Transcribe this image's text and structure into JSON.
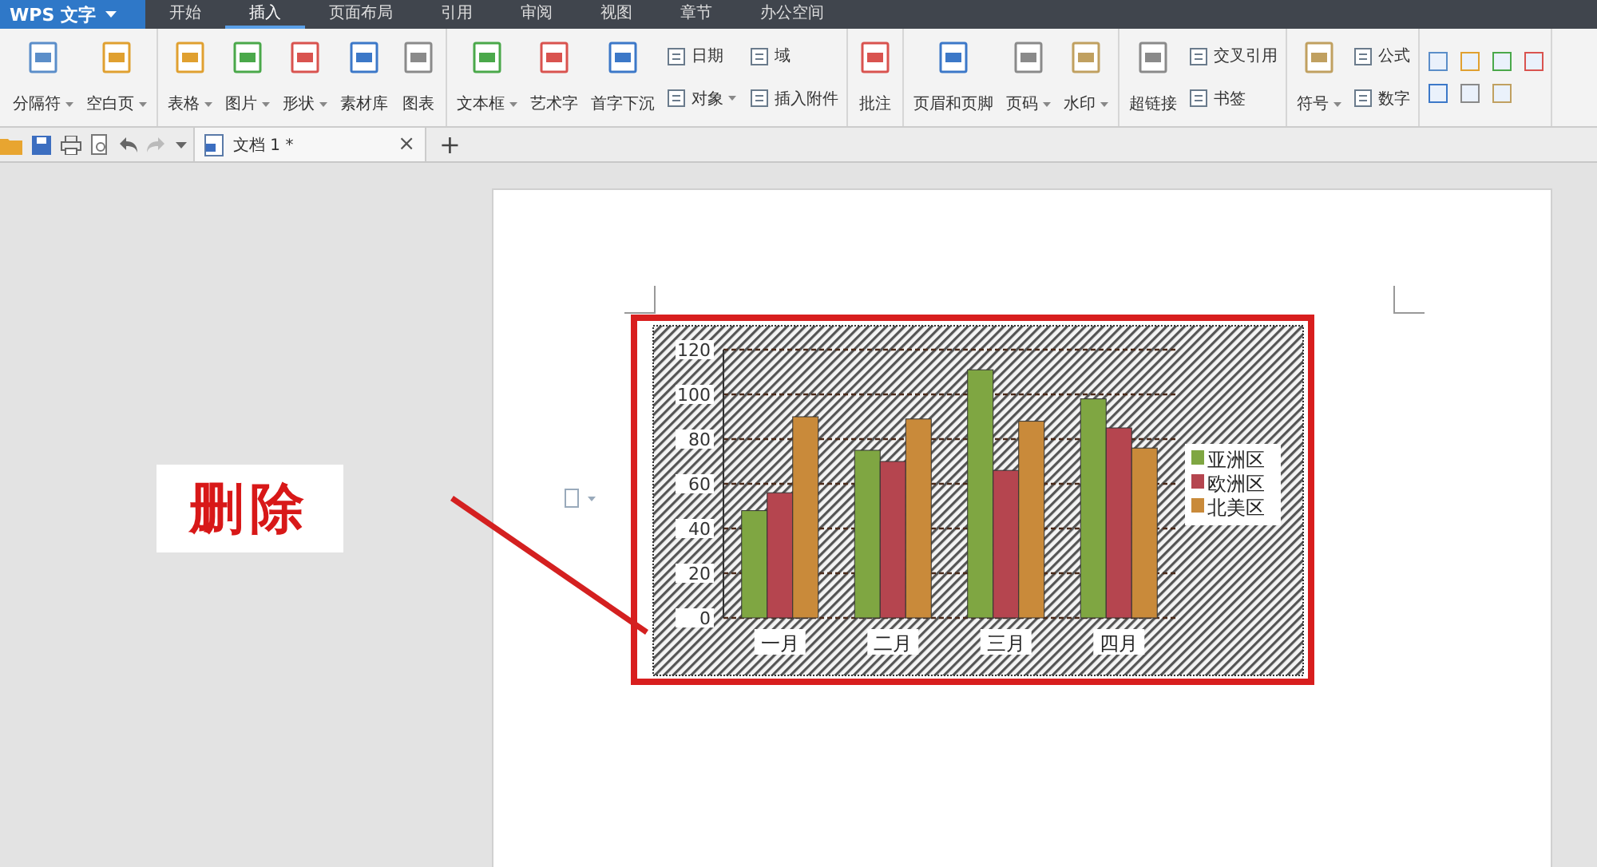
{
  "app_menu": {
    "label": "WPS 文字",
    "dropdown": true
  },
  "menu_tabs": [
    {
      "label": "开始",
      "selected": false
    },
    {
      "label": "插入",
      "selected": true
    },
    {
      "label": "页面布局",
      "selected": false
    },
    {
      "label": "引用",
      "selected": false
    },
    {
      "label": "审阅",
      "selected": false
    },
    {
      "label": "视图",
      "selected": false
    },
    {
      "label": "章节",
      "selected": false
    },
    {
      "label": "办公空间",
      "selected": false
    }
  ],
  "ribbon_groups": [
    {
      "items": [
        {
          "kind": "large",
          "label": "分隔符",
          "dropdown": true
        },
        {
          "kind": "large",
          "label": "空白页",
          "dropdown": true
        }
      ]
    },
    {
      "items": [
        {
          "kind": "large",
          "label": "表格",
          "dropdown": true
        },
        {
          "kind": "large",
          "label": "图片",
          "dropdown": true
        },
        {
          "kind": "large",
          "label": "形状",
          "dropdown": true
        },
        {
          "kind": "large",
          "label": "素材库",
          "dropdown": false
        },
        {
          "kind": "large",
          "label": "图表",
          "dropdown": false
        }
      ]
    },
    {
      "items": [
        {
          "kind": "large",
          "label": "文本框",
          "dropdown": true
        },
        {
          "kind": "large",
          "label": "艺术字",
          "dropdown": false
        },
        {
          "kind": "large",
          "label": "首字下沉",
          "dropdown": false
        },
        {
          "kind": "small",
          "label": "日期",
          "dropdown": false
        },
        {
          "kind": "small",
          "label": "对象",
          "dropdown": true
        },
        {
          "kind": "small",
          "label": "域",
          "dropdown": false
        },
        {
          "kind": "small",
          "label": "插入附件",
          "dropdown": false
        }
      ]
    },
    {
      "items": [
        {
          "kind": "large",
          "label": "批注",
          "dropdown": false
        }
      ]
    },
    {
      "items": [
        {
          "kind": "large",
          "label": "页眉和页脚",
          "dropdown": false
        },
        {
          "kind": "large",
          "label": "页码",
          "dropdown": true
        },
        {
          "kind": "large",
          "label": "水印",
          "dropdown": true
        }
      ]
    },
    {
      "items": [
        {
          "kind": "large",
          "label": "超链接",
          "dropdown": false
        },
        {
          "kind": "small",
          "label": "交叉引用",
          "dropdown": false
        },
        {
          "kind": "small",
          "label": "书签",
          "dropdown": false
        }
      ]
    },
    {
      "items": [
        {
          "kind": "large",
          "label": "符号",
          "dropdown": true
        },
        {
          "kind": "small",
          "label": "公式",
          "dropdown": false
        },
        {
          "kind": "small",
          "label": "数字",
          "dropdown": false
        }
      ]
    },
    {
      "items": [
        {
          "kind": "icon"
        },
        {
          "kind": "icon"
        },
        {
          "kind": "icon"
        },
        {
          "kind": "icon"
        },
        {
          "kind": "icon"
        },
        {
          "kind": "icon"
        },
        {
          "kind": "icon"
        }
      ]
    }
  ],
  "doc_tab": {
    "label": "文档 1 *",
    "close": "×",
    "new_tab": "+"
  },
  "chart": {
    "chart_data": {
      "type": "bar",
      "grid": true,
      "legend": true,
      "categories": [
        "一月",
        "二月",
        "三月",
        "四月"
      ],
      "ylim": [
        0,
        120
      ],
      "yticks": [
        0,
        20,
        40,
        60,
        80,
        100,
        120
      ],
      "series": [
        {
          "name": "亚洲区",
          "color": "#7fa642",
          "values": [
            48,
            75,
            111,
            98
          ]
        },
        {
          "name": "欧洲区",
          "color": "#b5454f",
          "values": [
            56,
            70,
            66,
            85
          ]
        },
        {
          "name": "北美区",
          "color": "#c98a3a",
          "values": [
            90,
            89,
            88,
            76
          ]
        }
      ]
    }
  },
  "annotation": {
    "label": "删除"
  }
}
